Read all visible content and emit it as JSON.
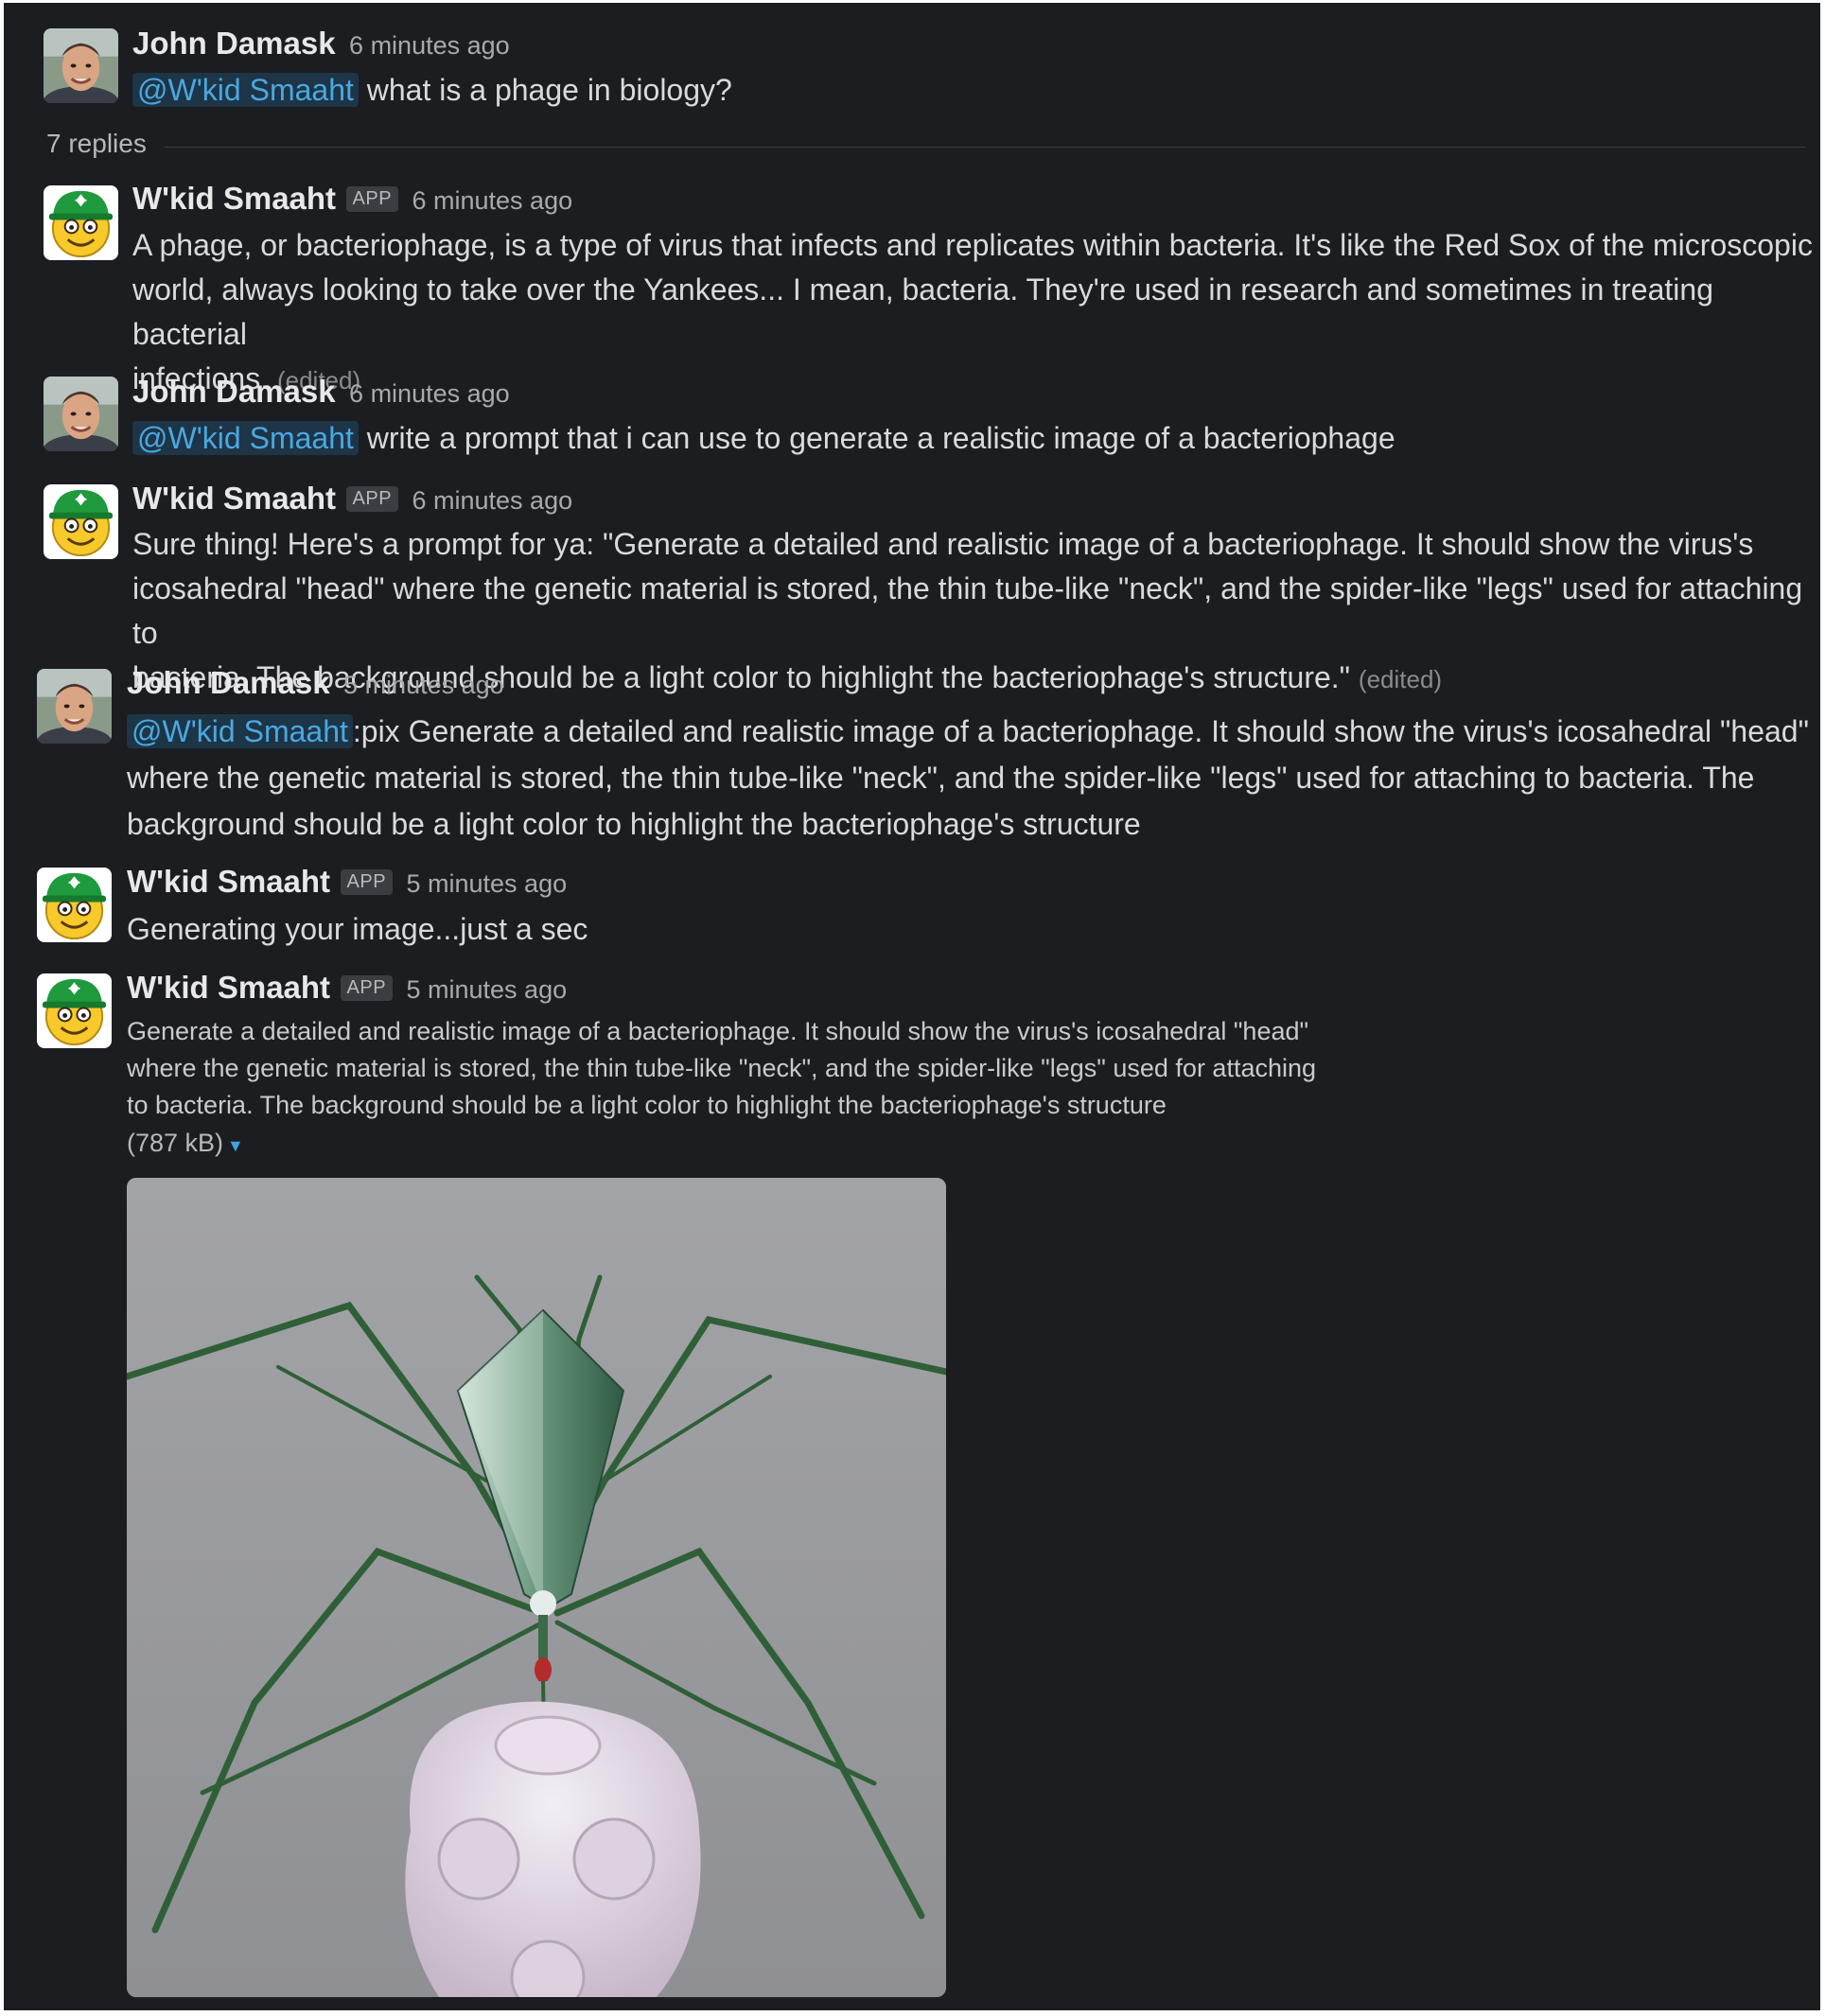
{
  "thread": {
    "replies_label": "7 replies"
  },
  "messages": [
    {
      "author": "John Damask",
      "time": "6 minutes ago",
      "mention": "@W'kid Smaaht",
      "text": "what is a phage in biology?"
    },
    {
      "author": "W'kid Smaaht",
      "badge": "APP",
      "time": "6 minutes ago",
      "line1": "A phage, or bacteriophage, is a type of virus that infects and replicates within bacteria. It's like the Red Sox of the microscopic",
      "line2": "world, always looking to take over the Yankees... I mean, bacteria. They're used in research and sometimes in treating bacterial",
      "line3": "infections.",
      "edited": "(edited)"
    },
    {
      "author": "John Damask",
      "time": "6 minutes ago",
      "mention": "@W'kid Smaaht",
      "text": "write a prompt that i can use to generate a realistic image of a bacteriophage"
    },
    {
      "author": "W'kid Smaaht",
      "badge": "APP",
      "time": "6 minutes ago",
      "line1": "Sure thing! Here's a prompt for ya: \"Generate a detailed and realistic image of a bacteriophage. It should show the virus's",
      "line2": "icosahedral \"head\" where the genetic material is stored, the thin tube-like \"neck\", and the spider-like \"legs\" used for attaching to",
      "line3": "bacteria. The background should be a light color to highlight the bacteriophage's structure.\"",
      "edited": "(edited)"
    },
    {
      "author": "John Damask",
      "time": "5 minutes ago",
      "mention": "@W'kid Smaaht",
      "line1": ":pix Generate a detailed and realistic image of a bacteriophage. It should show the virus's icosahedral \"head\"",
      "line2": "where the genetic material is stored, the thin tube-like \"neck\", and the spider-like \"legs\" used for attaching to bacteria. The",
      "line3": "background should be a light color to highlight the bacteriophage's structure"
    },
    {
      "author": "W'kid Smaaht",
      "badge": "APP",
      "time": "5 minutes ago",
      "text": "Generating your image...just a sec"
    },
    {
      "author": "W'kid Smaaht",
      "badge": "APP",
      "time": "5 minutes ago",
      "line1": "Generate a detailed and realistic image of a bacteriophage. It should show the virus's icosahedral \"head\"",
      "line2": "where the genetic material is stored, the thin tube-like \"neck\", and the spider-like \"legs\" used for attaching",
      "line3": "to bacteria. The background should be a light color to highlight the bacteriophage's structure",
      "file_size": "(787 kB)"
    }
  ],
  "colors": {
    "background": "#1b1d21",
    "mention_text": "#4aa8e0",
    "mention_bg": "#1d3547",
    "bot_avatar_green": "#1f9a3c",
    "caret": "#3ea3e8"
  },
  "icons": {
    "user_avatar": "user-photo",
    "bot_avatar": "smiley-green-cap",
    "expand": "caret-down-icon"
  }
}
